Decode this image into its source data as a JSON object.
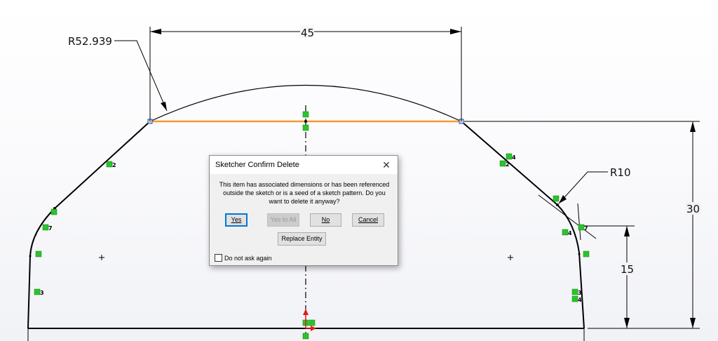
{
  "sketch": {
    "dimensions": {
      "radius_arc": "R52.939",
      "width_top": "45",
      "radius_fillet": "R10",
      "height_total": "30",
      "height_lower": "15"
    },
    "relation_marks": {
      "left_line": "2",
      "left_fillet_mid": "7",
      "left_bottom": "3",
      "right_line_a": "4",
      "right_line_b": "2",
      "right_fillet_a": "7",
      "right_fillet_b": "4",
      "right_bottom_a": "3",
      "right_bottom_b": "4"
    },
    "colors": {
      "geometry": "#000000",
      "selected_line": "#f29a33",
      "relation_marker": "#29c529",
      "origin_arrow": "#e01d1d"
    }
  },
  "dialog": {
    "title": "Sketcher Confirm Delete",
    "close_symbol": "✕",
    "message": "This item has associated dimensions or has been referenced outside the sketch or is a seed of a sketch pattern. Do you want to delete it anyway?",
    "buttons": {
      "yes": "Yes",
      "yes_to_all": "Yes to All",
      "no": "No",
      "cancel": "Cancel",
      "replace_entity": "Replace Entity"
    },
    "checkbox_label": "Do not ask again"
  }
}
